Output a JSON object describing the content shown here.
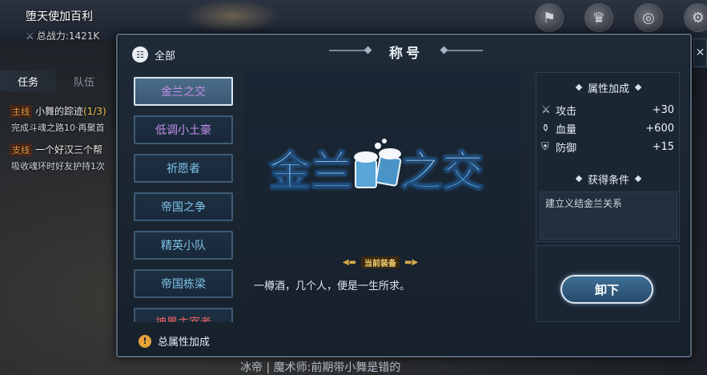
{
  "hud": {
    "title": "堕天使加百利",
    "power_label": "总战力:",
    "power_value": "1421K",
    "icons": [
      "activity-icon",
      "trophy-icon",
      "globe-icon",
      "settings-icon"
    ]
  },
  "left_panel": {
    "tabs": [
      {
        "label": "任务",
        "active": true
      },
      {
        "label": "队伍",
        "active": false
      }
    ],
    "quests": [
      {
        "tag": "主线",
        "title": "小舞的踪迹",
        "progress": "(1/3)",
        "desc": "完成斗魂之路10·再聚首"
      },
      {
        "tag": "支线",
        "title": "一个好汉三个帮",
        "progress": "",
        "desc": "吸收魂环时好友护持1次"
      }
    ]
  },
  "bottom_chat": "冰帝 | 魔术师:前期带小舞是错的",
  "panel": {
    "filter_label": "全部",
    "title": "称号",
    "titles": [
      {
        "label": "金兰之交",
        "state": "active",
        "color": "purple"
      },
      {
        "label": "低调小土豪",
        "state": "normal",
        "color": "purple"
      },
      {
        "label": "祈愿者",
        "state": "normal",
        "color": "blue"
      },
      {
        "label": "帝国之争",
        "state": "normal",
        "color": "blue"
      },
      {
        "label": "精英小队",
        "state": "normal",
        "color": "blue"
      },
      {
        "label": "帝国栋梁",
        "state": "normal",
        "color": "blue"
      },
      {
        "label": "神界主宰者",
        "state": "normal",
        "color": "red"
      }
    ],
    "selected": {
      "logo_text": "金兰之交",
      "equipped_badge": "当前装备",
      "description": "一樽酒，几个人，便是一生所求。"
    },
    "attributes": {
      "header": "属性加成",
      "rows": [
        {
          "icon": "sword-icon",
          "name": "攻击",
          "value": "+30"
        },
        {
          "icon": "potion-icon",
          "name": "血量",
          "value": "+600"
        },
        {
          "icon": "shield-icon",
          "name": "防御",
          "value": "+15"
        }
      ]
    },
    "condition": {
      "header": "获得条件",
      "text": "建立义结金兰关系"
    },
    "unequip_label": "卸下",
    "footer_label": "总属性加成"
  },
  "colors": {
    "purple_text": "#c68ee8",
    "blue_text": "#7fc4e8",
    "red_text": "#ec6262",
    "gold": "#f4d070"
  }
}
